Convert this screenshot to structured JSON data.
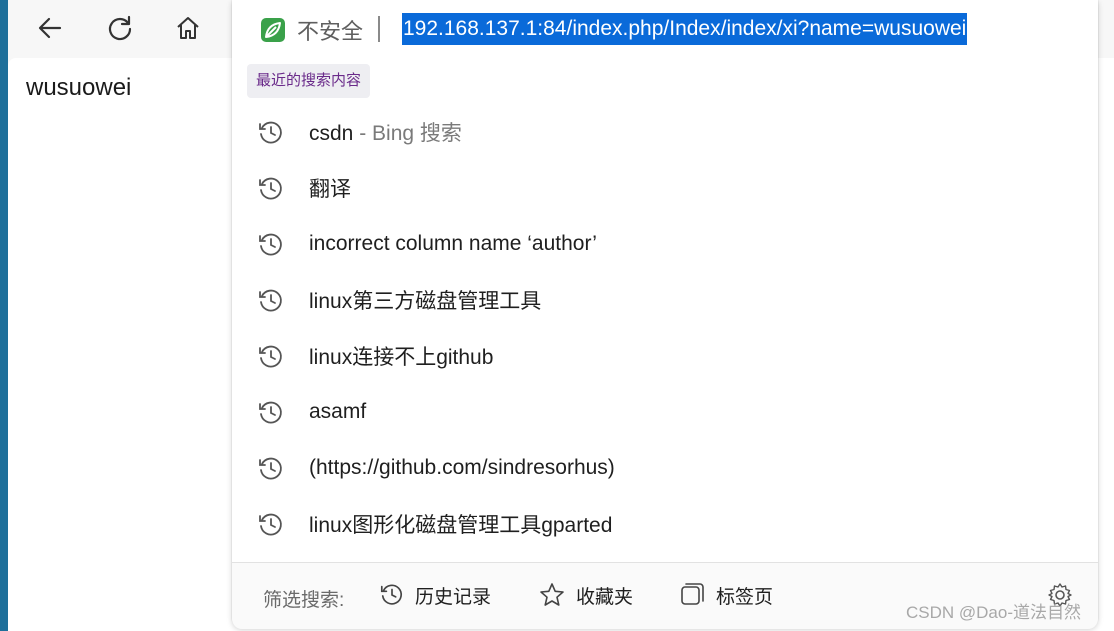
{
  "page": {
    "content_text": "wusuowei"
  },
  "address_bar": {
    "security_label": "不安全",
    "separator": "|",
    "url": "192.168.137.1:84/index.php/Index/index/xi?name=wusuowei"
  },
  "dropdown": {
    "section_label": "最近的搜索内容",
    "suggestions": [
      {
        "text": "csdn",
        "sub": " - Bing 搜索"
      },
      {
        "text": "翻译",
        "sub": ""
      },
      {
        "text": "incorrect column name ‘author’",
        "sub": ""
      },
      {
        "text": "linux第三方磁盘管理工具",
        "sub": ""
      },
      {
        "text": "linux连接不上github",
        "sub": ""
      },
      {
        "text": "asamf",
        "sub": ""
      },
      {
        "text": "(https://github.com/sindresorhus)",
        "sub": ""
      },
      {
        "text": "linux图形化磁盘管理工具gparted",
        "sub": ""
      }
    ],
    "footer": {
      "filter_label": "筛选搜索:",
      "history_label": "历史记录",
      "favorites_label": "收藏夹",
      "tabs_label": "标签页"
    }
  },
  "icons": {
    "back": "arrow-left-icon",
    "refresh": "refresh-icon",
    "home": "home-icon",
    "security": "leaf-shield-icon",
    "history_item": "clock-history-icon",
    "favorites": "star-icon",
    "tabs": "tabs-icon",
    "settings": "gear-icon"
  },
  "colors": {
    "selection": "#0a6ad9",
    "section_label": "#6a2a8a",
    "security_icon": "#3aa14a"
  },
  "watermark": "CSDN @Dao-道法自然"
}
